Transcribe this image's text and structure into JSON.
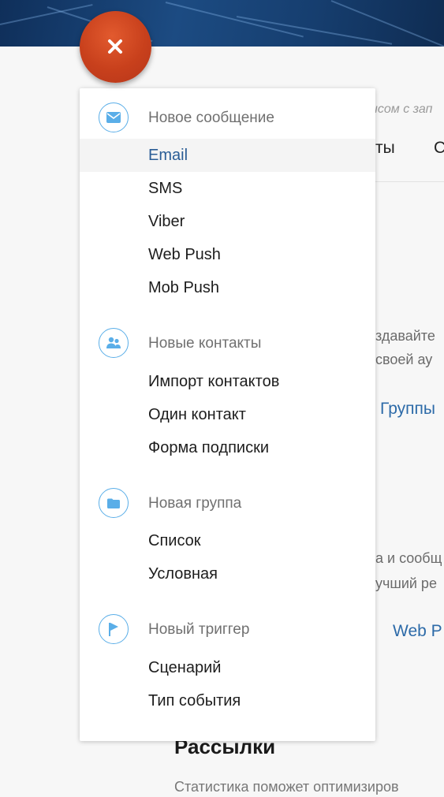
{
  "background": {
    "subtitle_fragment": "исом с зап",
    "tab_fragment_1": "ты",
    "tab_fragment_2": "С",
    "paragraph1_line1": "здавайте",
    "paragraph1_line2": "своей ау",
    "link_groups": "Группы",
    "paragraph2_line1": "а и сообщ",
    "paragraph2_line2": "учший ре",
    "link_webpush": "Web P",
    "heading": "Рассылки",
    "paragraph3": "Статистика поможет оптимизиров"
  },
  "fab": {
    "icon": "close-icon",
    "color": "#c8401c"
  },
  "menu": {
    "sections": [
      {
        "title": "Новое сообщение",
        "icon": "envelope-icon",
        "items": [
          "Email",
          "SMS",
          "Viber",
          "Web Push",
          "Mob Push"
        ]
      },
      {
        "title": "Новые контакты",
        "icon": "contacts-icon",
        "items": [
          "Импорт контактов",
          "Один контакт",
          "Форма подписки"
        ]
      },
      {
        "title": "Новая группа",
        "icon": "folder-icon",
        "items": [
          "Список",
          "Условная"
        ]
      },
      {
        "title": "Новый триггер",
        "icon": "flag-icon",
        "items": [
          "Сценарий",
          "Тип события"
        ]
      }
    ],
    "active_item": "Email"
  },
  "colors": {
    "accent": "#2c6aa8",
    "icon_blue": "#5aaee8",
    "fab": "#c8401c"
  }
}
